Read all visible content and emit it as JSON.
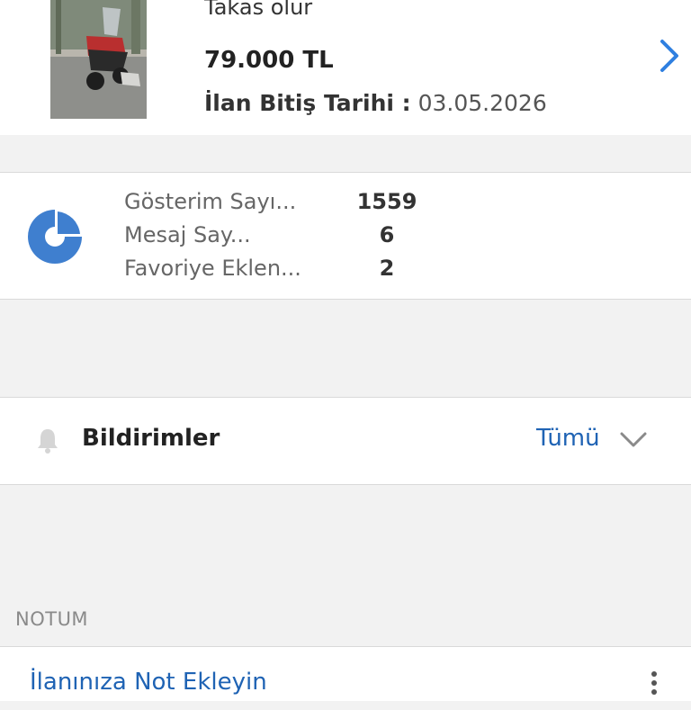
{
  "listing": {
    "tag": "Takas olur",
    "price": "79.000 TL",
    "end_date_label": "İlan Bitiş Tarihi :",
    "end_date_value": "03.05.2026",
    "thumbnail_icon": "motorcycle-photo",
    "chevron_icon": "chevron-right-icon",
    "accent_color": "#2f7fe0"
  },
  "stats": {
    "icon": "pie-chart-icon",
    "icon_color": "#3f7fcf",
    "rows": [
      {
        "label": "Gösterim Sayı...",
        "value": "1559"
      },
      {
        "label": "Mesaj Say...",
        "value": "6"
      },
      {
        "label": "Favoriye Eklen...",
        "value": "2"
      }
    ]
  },
  "notifications": {
    "icon": "bell-icon",
    "title": "Bildirimler",
    "filter_label": "Tümü",
    "filter_icon": "chevron-down-icon",
    "link_color": "#1f63b4"
  },
  "note": {
    "section_header": "NOTUM",
    "add_link": "İlanınıza Not Ekleyin",
    "more_icon": "more-vertical-icon"
  }
}
